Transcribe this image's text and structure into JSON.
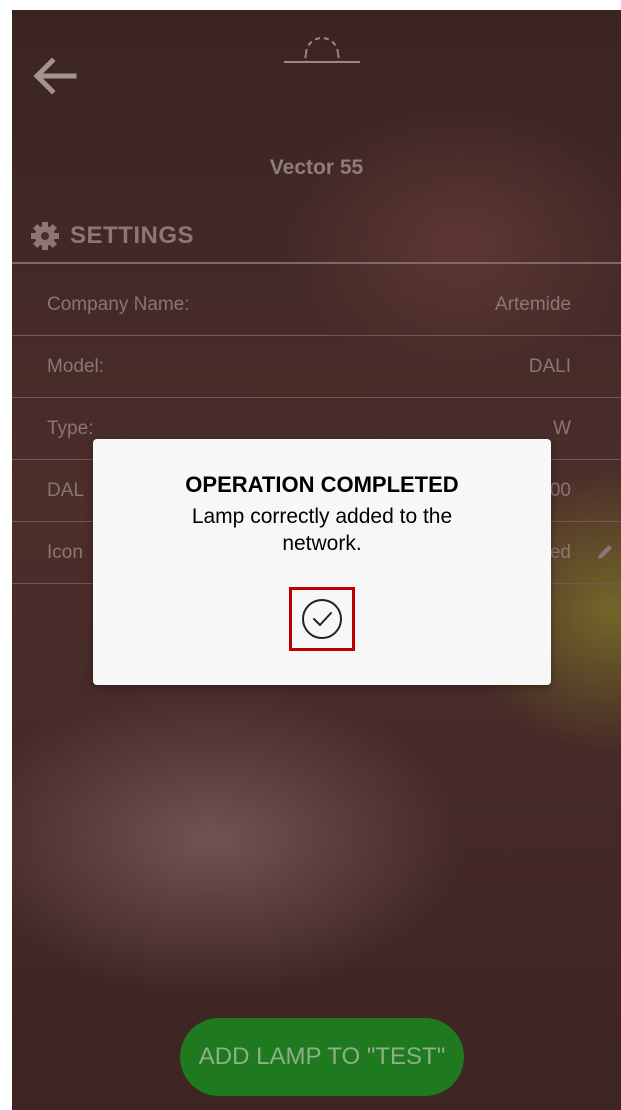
{
  "header": {
    "title": "Vector 55",
    "back_icon": "back-arrow-icon",
    "lamp_icon": "lamp-icon"
  },
  "settings": {
    "heading": "SETTINGS",
    "icon": "gear-icon",
    "rows": [
      {
        "label": "Company Name:",
        "value": "Artemide"
      },
      {
        "label": "Model:",
        "value": "DALI"
      },
      {
        "label": "Type:",
        "value": "W"
      },
      {
        "label": "DAL",
        "value": "00"
      },
      {
        "label": "Icon",
        "value": "ed",
        "edit_icon": "pencil-icon"
      }
    ]
  },
  "footer": {
    "add_button_label": "ADD LAMP TO \"TEST\""
  },
  "dialog": {
    "title": "OPERATION COMPLETED",
    "message": "Lamp correctly added to the network.",
    "confirm_icon": "check-circle-icon"
  },
  "colors": {
    "dialog_bg": "#f7f7f7",
    "highlight_border": "#c00000",
    "button_green": "#1f7a1f"
  }
}
